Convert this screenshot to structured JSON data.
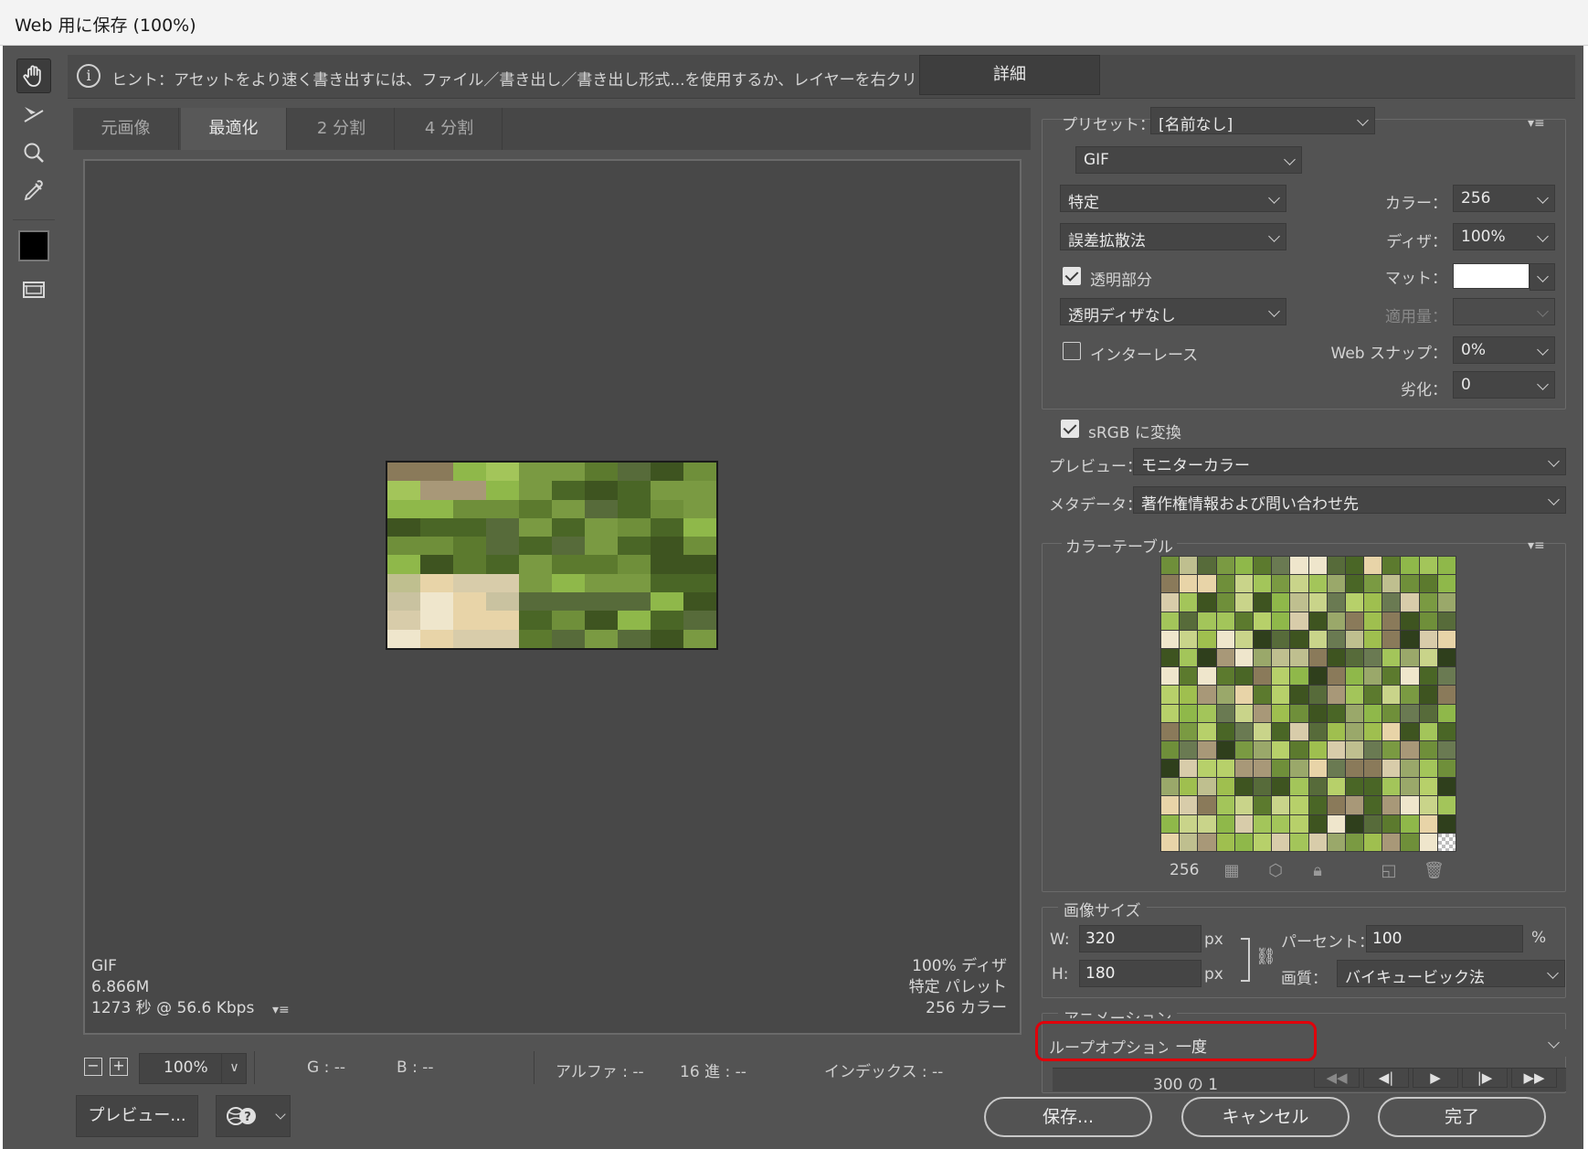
{
  "window": {
    "title": "Web 用に保存 (100%)"
  },
  "hint": {
    "text": "ヒント：アセットをより速く書き出すには、ファイル／書き出し／書き出し形式...を使用するか、レイヤーを右クリックして使用。",
    "detail_label": "詳細",
    "info_glyph": "i"
  },
  "tools": [
    "hand-icon",
    "slice-select-icon",
    "zoom-icon",
    "eyedropper-icon",
    "color-swatch-icon",
    "slice-visibility-icon"
  ],
  "tabs": [
    {
      "label": "元画像",
      "active": false
    },
    {
      "label": "最適化",
      "active": true
    },
    {
      "label": "2 分割",
      "active": false
    },
    {
      "label": "4 分割",
      "active": false
    }
  ],
  "image_info": {
    "format": "GIF",
    "size": "6.866M",
    "time": "1273 秒 @ 56.6 Kbps",
    "dither": "100% ディザ",
    "palette": "特定 パレット",
    "colors": "256 カラー"
  },
  "status": {
    "zoom": "100%",
    "g": "G : --",
    "b": "B : --",
    "alpha": "アルファ : --",
    "hex": "16 進 : --",
    "index": "インデックス : --"
  },
  "buttons": {
    "preview": "プレビュー...",
    "save": "保存...",
    "cancel": "キャンセル",
    "done": "完了"
  },
  "settings": {
    "preset_label": "プリセット：",
    "preset_value": "[名前なし]",
    "format": "GIF",
    "reduction": "特定",
    "colors_label": "カラー：",
    "colors_value": "256",
    "dither_algo": "誤差拡散法",
    "dither_label": "ディザ：",
    "dither_value": "100%",
    "transparency_label": "透明部分",
    "transparency_checked": true,
    "matte_label": "マット：",
    "matte_color": "#ffffff",
    "trans_dither": "透明ディザなし",
    "amount_label": "適用量：",
    "interlace_label": "インターレース",
    "interlace_checked": false,
    "websnap_label": "Web スナップ：",
    "websnap_value": "0%",
    "lossy_label": "劣化：",
    "lossy_value": "0",
    "srgb_label": "sRGB に変換",
    "srgb_checked": true,
    "preview_label": "プレビュー：",
    "preview_value": "モニターカラー",
    "metadata_label": "メタデータ：",
    "metadata_value": "著作権情報および問い合わせ先"
  },
  "color_table": {
    "title": "カラーテーブル",
    "count": "256"
  },
  "image_size": {
    "title": "画像サイズ",
    "w_label": "W:",
    "w_value": "320",
    "w_unit": "px",
    "h_label": "H:",
    "h_value": "180",
    "h_unit": "px",
    "percent_label": "パーセント：",
    "percent_value": "100",
    "percent_unit": "%",
    "quality_label": "画質：",
    "quality_value": "バイキュービック法"
  },
  "animation": {
    "title": "アニメーション",
    "loop_label": "ループオプション：",
    "loop_value": "一度",
    "frame_counter": "300 の 1"
  },
  "colors": {
    "dialog_bg": "#535353",
    "highlight": "#e0000a"
  }
}
